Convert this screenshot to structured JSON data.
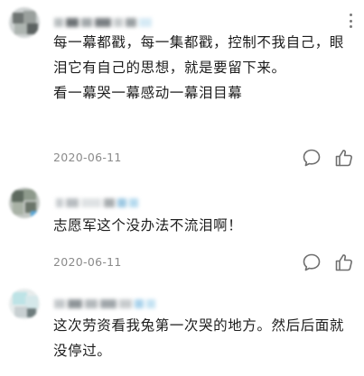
{
  "comments": [
    {
      "paragraphs": [
        "每一幕都戳，每一集都戳，控制不我自己，眼泪它有自己的思想，就是要留下来。",
        "看一幕哭一幕感动一幕泪目幕"
      ],
      "date": "2020-06-11",
      "reply_icon": "comment-bubble-icon",
      "like_icon": "thumbs-up-icon"
    },
    {
      "paragraphs": [
        "志愿军这个没办法不流泪啊！"
      ],
      "date": "2020-06-11",
      "reply_icon": "comment-bubble-icon",
      "like_icon": "thumbs-up-icon"
    },
    {
      "paragraphs": [
        "这次劳资看我兔第一次哭的地方。然后后面就没停过。"
      ]
    }
  ],
  "icons": {
    "more": "more-vertical-icon"
  },
  "colors": {
    "background": "#ffffff",
    "body_text": "#1d1d1d",
    "meta_text": "#8a8a8a",
    "icon_stroke": "#6f6f6f"
  }
}
